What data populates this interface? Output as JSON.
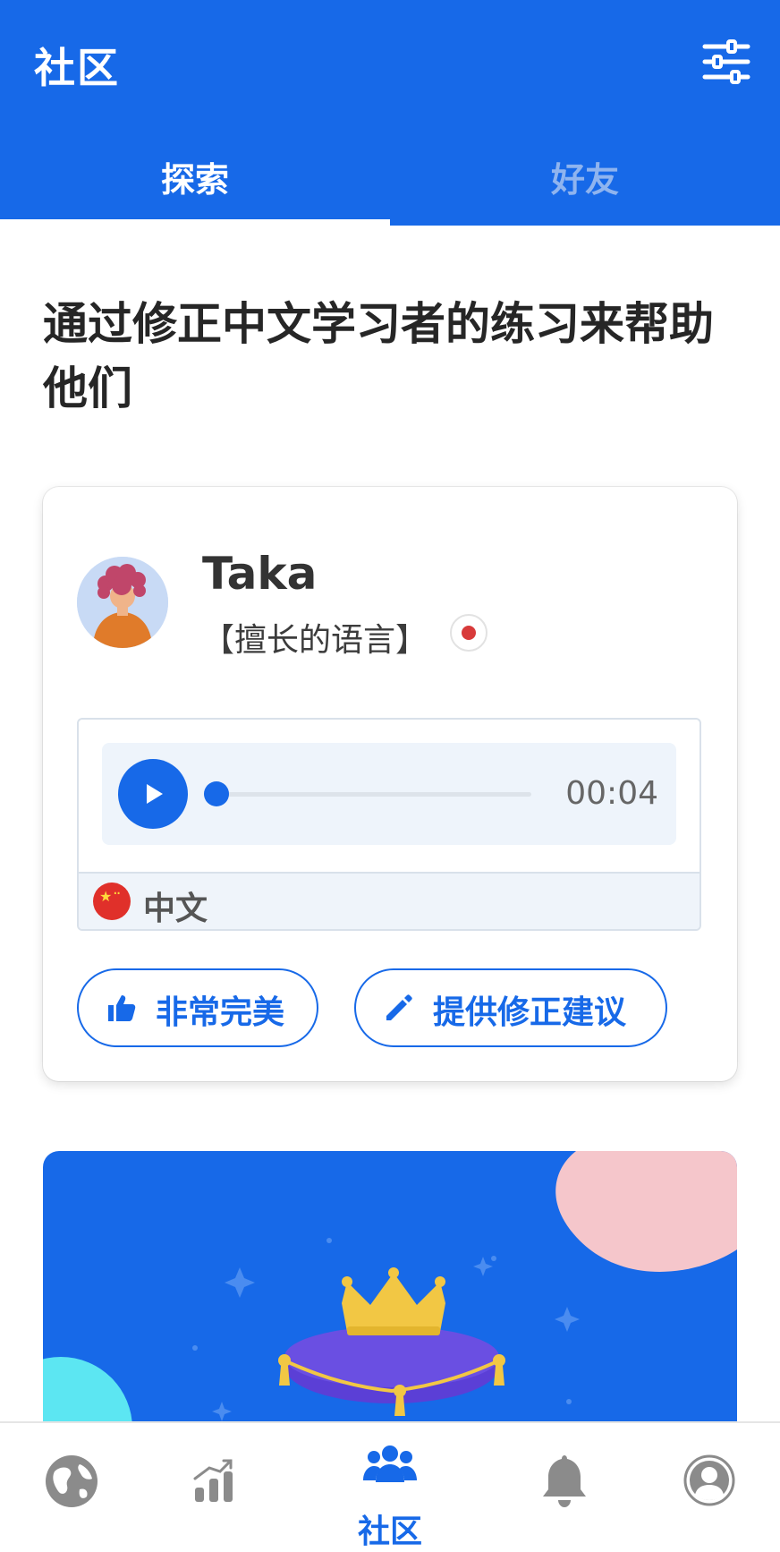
{
  "header": {
    "title": "社区",
    "filter_icon": "sliders-icon"
  },
  "tabs": [
    {
      "label": "探索",
      "active": true
    },
    {
      "label": "好友",
      "active": false
    }
  ],
  "headline": "通过修正中文学习者的练习来帮助他们",
  "post": {
    "user_name": "Taka",
    "languages_label": "【擅长的语言】",
    "native_flag": "japan-flag-icon",
    "audio": {
      "duration": "00:04",
      "progress": 0
    },
    "language": {
      "flag": "china-flag-icon",
      "name": "中文"
    },
    "actions": {
      "perfect_label": "非常完美",
      "suggest_label": "提供修正建议"
    }
  },
  "bottom_nav": {
    "community_label": "社区",
    "active": "community"
  },
  "colors": {
    "brand_blue": "#1769e8",
    "tab_inactive": "#8fb4ef",
    "promo_pink": "#f5c6cb",
    "promo_cyan": "#5ce6f2"
  }
}
